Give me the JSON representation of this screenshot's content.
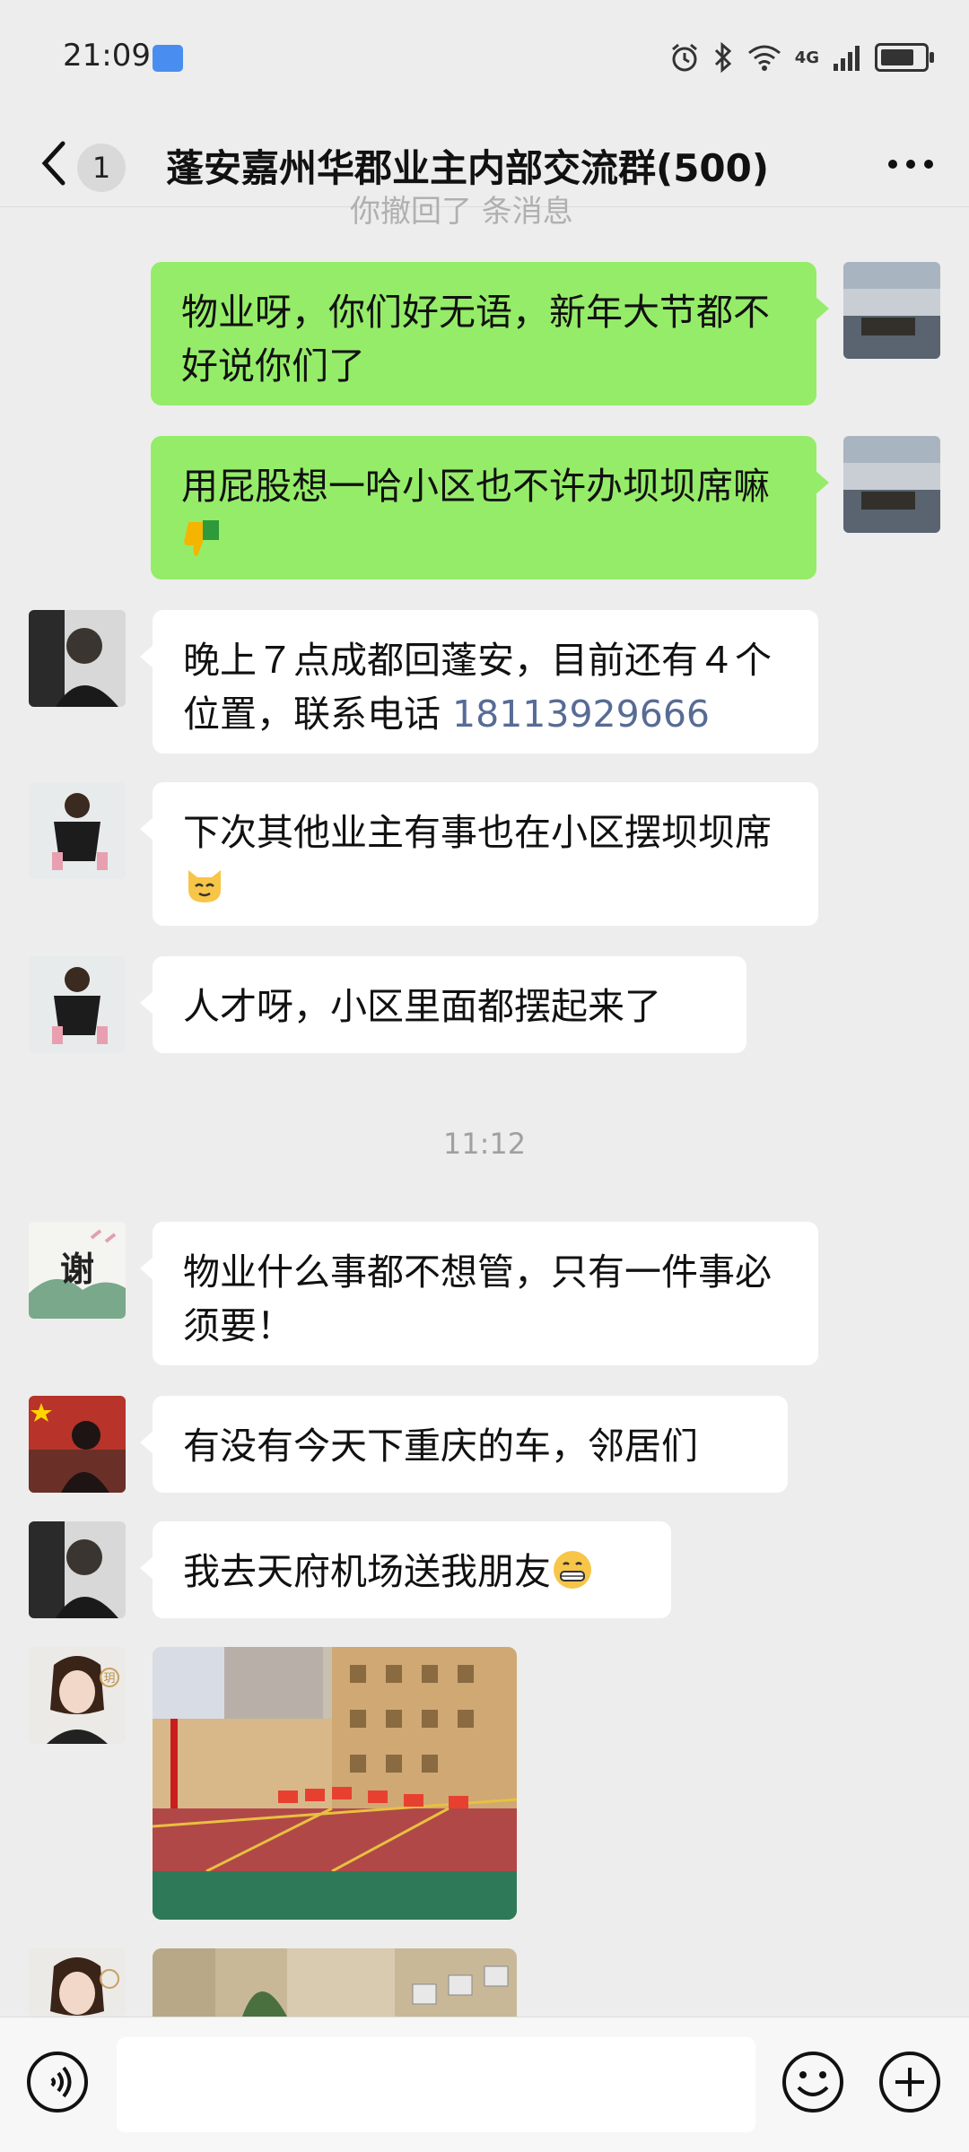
{
  "status_bar": {
    "time": "21:09",
    "network": "4G",
    "battery_level": 0.85
  },
  "header": {
    "unread_count": "1",
    "title": "蓬安嘉州华郡业主内部交流群(500)"
  },
  "scrolled_partial_text": "你撤回了 条消息",
  "messages": [
    {
      "side": "out",
      "text": "物业呀，你们好无语，新年大节都不好说你们了"
    },
    {
      "side": "out",
      "text": "用屁股想一哈小区也不许办坝坝席嘛",
      "emoji": "thumbs-down"
    },
    {
      "side": "in",
      "text": "晚上７点成都回蓬安，目前还有４个位置，联系电话 ",
      "link": "18113929666"
    },
    {
      "side": "in",
      "text": "下次其他业主有事也在小区摆坝坝席",
      "emoji": "cat-face"
    },
    {
      "side": "in",
      "text": "人才呀，小区里面都摆起来了"
    },
    {
      "side": "in",
      "text": "物业什么事都不想管，只有一件事必须要！"
    },
    {
      "side": "in",
      "text": "有没有今天下重庆的车，邻居们"
    },
    {
      "side": "in",
      "text": "我去天府机场送我朋友",
      "emoji": "grin-face"
    }
  ],
  "time_divider": "11:12",
  "avatar_glyphs": {
    "xie": "谢",
    "badge": "玥"
  },
  "input": {
    "placeholder": ""
  },
  "colors": {
    "background": "#ededed",
    "outgoing_bubble": "#95ec69",
    "incoming_bubble": "#ffffff",
    "link": "#576b95"
  }
}
